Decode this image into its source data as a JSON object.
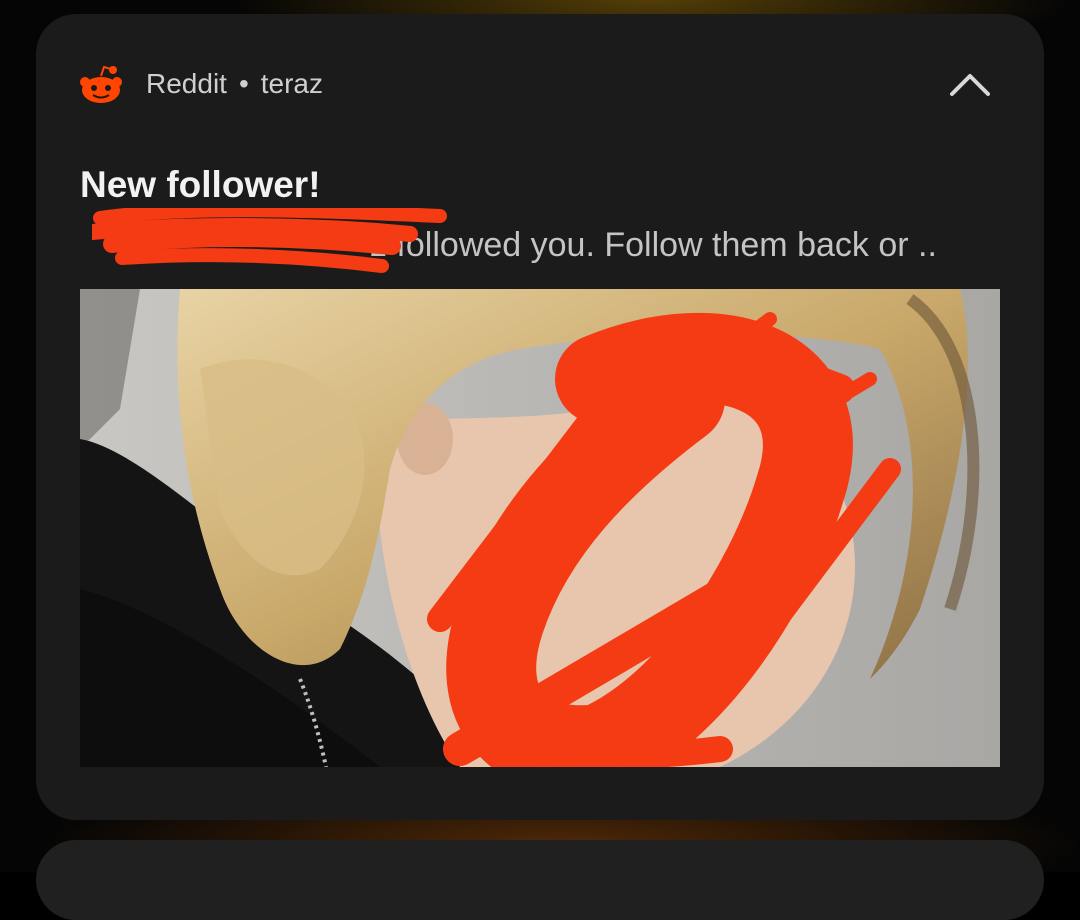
{
  "notification": {
    "app_name": "Reddit",
    "separator": "•",
    "time": "teraz",
    "title": "New follower!",
    "body_visible": "z followed you. Follow them back or ..",
    "app_icon": "reddit-snoo-icon",
    "collapse_icon": "chevron-up-icon"
  },
  "colors": {
    "card_bg": "#1b1b1b",
    "reddit_orange": "#ff4500",
    "redaction": "#f53b13",
    "title_text": "#f2f2f2",
    "body_text": "#c4c4c4"
  }
}
